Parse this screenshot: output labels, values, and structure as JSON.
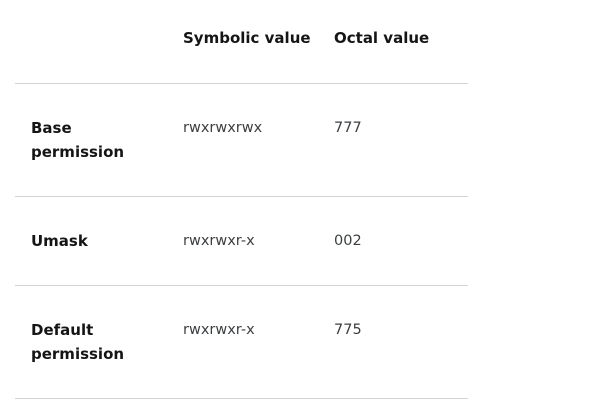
{
  "table": {
    "headers": [
      "",
      "Symbolic value",
      "Octal value"
    ],
    "rows": [
      {
        "label": "Base permission",
        "symbolic": "rwxrwxrwx",
        "octal": "777"
      },
      {
        "label": "Umask",
        "symbolic": "rwxrwxr-x",
        "octal": "002"
      },
      {
        "label": "Default permission",
        "symbolic": "rwxrwxr-x",
        "octal": "775"
      }
    ]
  }
}
